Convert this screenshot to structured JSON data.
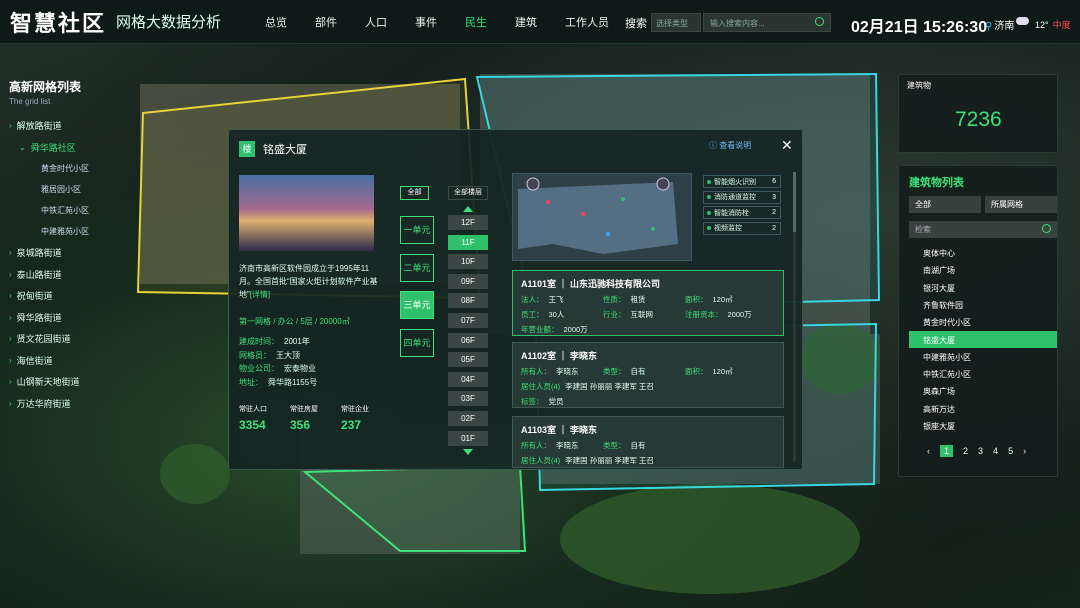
{
  "header": {
    "logo": "智慧社区",
    "subtitle": "网格大数据分析",
    "nav": [
      {
        "label": "总览"
      },
      {
        "label": "部件"
      },
      {
        "label": "人口"
      },
      {
        "label": "事件"
      },
      {
        "label": "民生",
        "active": true
      },
      {
        "label": "建筑"
      },
      {
        "label": "工作人员"
      }
    ],
    "search_label": "搜索",
    "search_type": "选择类型",
    "search_placeholder": "输入搜索内容...",
    "datetime": "02月21日 15:26:30",
    "city": "济南",
    "temperature": "12°",
    "weather_level": "中度"
  },
  "grid_list": {
    "title": "高新网格列表",
    "subtitle": "The grid list",
    "items": [
      {
        "label": "解放路街道",
        "level": 1
      },
      {
        "label": "舜华路社区",
        "level": 2
      },
      {
        "label": "黄金时代小区",
        "level": 3
      },
      {
        "label": "雅居园小区",
        "level": 3
      },
      {
        "label": "中铁汇苑小区",
        "level": 3
      },
      {
        "label": "中建雅苑小区",
        "level": 3
      },
      {
        "label": "泉城路街道",
        "level": 1
      },
      {
        "label": "泰山路街道",
        "level": 1
      },
      {
        "label": "祝甸街道",
        "level": 1
      },
      {
        "label": "舜华路街道",
        "level": 1
      },
      {
        "label": "贤文花园街道",
        "level": 1
      },
      {
        "label": "海信街道",
        "level": 1
      },
      {
        "label": "山钢新天地街道",
        "level": 1
      },
      {
        "label": "万达华府街道",
        "level": 1
      }
    ]
  },
  "popup": {
    "icon": "楼",
    "title": "铭盛大厦",
    "help": "ⓘ 查看说明",
    "close": "✕",
    "description": "济南市高新区软件园成立于1995年11月。全国首批“国家火炬计划软件产业基地”",
    "more_link": "[详情]",
    "tags": "第一网格 / 办公 / 5层 / 20000㎡",
    "info": [
      {
        "k": "建成时间：",
        "v": "2001年"
      },
      {
        "k": "网格员：",
        "v": "王大顶"
      },
      {
        "k": "物业公司：",
        "v": "宏泰物业"
      },
      {
        "k": "地址：",
        "v": "舜华路1155号"
      }
    ],
    "stats": [
      {
        "label": "常驻人口",
        "value": "3354"
      },
      {
        "label": "常驻房屋",
        "value": "356"
      },
      {
        "label": "常驻企业",
        "value": "237"
      }
    ],
    "all_label": "全部",
    "floors_label": "全部楼层",
    "units": [
      {
        "label": "一单元"
      },
      {
        "label": "二单元"
      },
      {
        "label": "三单元",
        "active": true
      },
      {
        "label": "四单元"
      }
    ],
    "floors": [
      {
        "label": "12F"
      },
      {
        "label": "11F",
        "active": true
      },
      {
        "label": "10F"
      },
      {
        "label": "09F"
      },
      {
        "label": "08F"
      },
      {
        "label": "07F"
      },
      {
        "label": "06F"
      },
      {
        "label": "05F"
      },
      {
        "label": "04F"
      },
      {
        "label": "03F"
      },
      {
        "label": "02F"
      },
      {
        "label": "01F"
      }
    ],
    "legend": [
      {
        "label": "智能烟火识别",
        "count": "6"
      },
      {
        "label": "消防通道监控",
        "count": "3"
      },
      {
        "label": "智能消防栓",
        "count": "2"
      },
      {
        "label": "视频监控",
        "count": "2"
      }
    ],
    "rooms": [
      {
        "title": "A1101室 ｜ 山东迅驰科技有限公司",
        "rows": [
          [
            {
              "k": "法人：",
              "v": "王飞"
            },
            {
              "k": "性质：",
              "v": "租赁"
            },
            {
              "k": "面积：",
              "v": "120㎡"
            }
          ],
          [
            {
              "k": "员工：",
              "v": "30人"
            },
            {
              "k": "行业：",
              "v": "互联网"
            },
            {
              "k": "注册资本：",
              "v": "2000万"
            }
          ],
          [
            {
              "k": "年营业额：",
              "v": "2000万"
            }
          ]
        ]
      },
      {
        "title": "A1102室 ｜ 李晓东",
        "rows": [
          [
            {
              "k": "所有人：",
              "v": "李晓东"
            },
            {
              "k": "类型：",
              "v": "自有"
            },
            {
              "k": "面积：",
              "v": "120㎡"
            }
          ],
          [
            {
              "k": "居住人员(4)",
              "v": "李建国 孙丽丽 李建军 王召"
            }
          ],
          [
            {
              "k": "标签：",
              "v": "党员"
            }
          ]
        ]
      },
      {
        "title": "A1103室 ｜ 李晓东",
        "rows": [
          [
            {
              "k": "所有人：",
              "v": "李晓东"
            },
            {
              "k": "类型：",
              "v": "自有"
            }
          ],
          [
            {
              "k": "居住人员(4)",
              "v": "李建国 孙丽丽 李建军 王召"
            }
          ]
        ]
      }
    ]
  },
  "buildings": {
    "label": "建筑物",
    "count": "7236",
    "list_title": "建筑物列表",
    "filter_all": "全部",
    "filter_grid": "所属网格",
    "search_placeholder": "检索",
    "items": [
      {
        "label": "奥体中心"
      },
      {
        "label": "南湖广场"
      },
      {
        "label": "银河大厦"
      },
      {
        "label": "齐鲁软件园"
      },
      {
        "label": "黄金时代小区"
      },
      {
        "label": "铭盛大厦",
        "active": true
      },
      {
        "label": "中建雅苑小区"
      },
      {
        "label": "中铁汇苑小区"
      },
      {
        "label": "奥森广场"
      },
      {
        "label": "高新万达"
      },
      {
        "label": "银座大厦"
      }
    ],
    "pages": [
      "1",
      "2",
      "3",
      "4",
      "5"
    ],
    "prev": "‹",
    "next": "›"
  },
  "colors": {
    "accent": "#2ec06a",
    "yellow_zone": "#e6d23a",
    "cyan_zone": "#38d6e0",
    "green_zone": "#3de07a"
  }
}
